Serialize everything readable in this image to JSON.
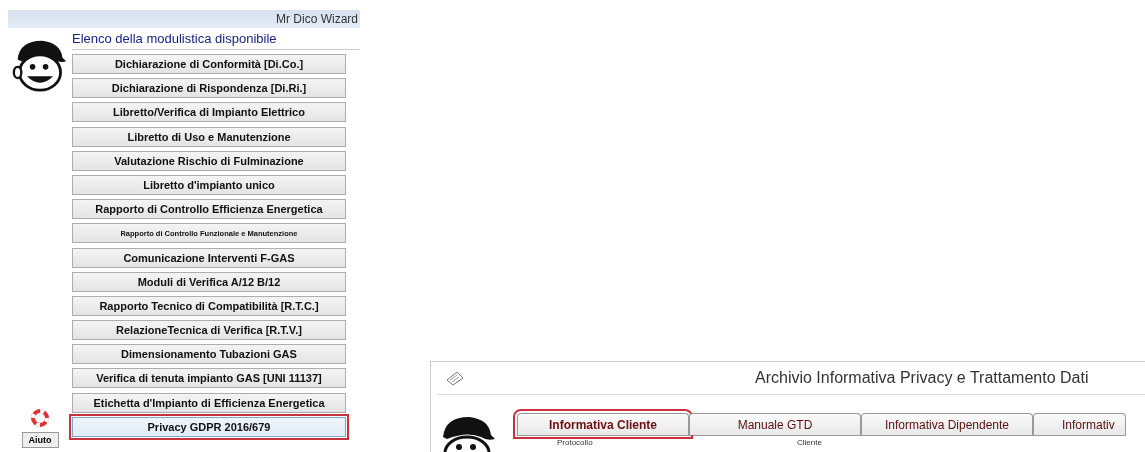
{
  "wizard": {
    "title": "Mr Dico Wizard",
    "heading": "Elenco della modulistica disponibile",
    "buttons": [
      {
        "label": "Dichiarazione di Conformità [Di.Co.]",
        "kind": "normal",
        "highlighted": false
      },
      {
        "label": "Dichiarazione di Rispondenza [Di.Ri.]",
        "kind": "normal",
        "highlighted": false
      },
      {
        "label": "Libretto/Verifica di Impianto Elettrico",
        "kind": "normal",
        "highlighted": false
      },
      {
        "label": "Libretto di Uso e Manutenzione",
        "kind": "normal",
        "highlighted": false
      },
      {
        "label": "Valutazione Rischio di Fulminazione",
        "kind": "normal",
        "highlighted": false
      },
      {
        "label": "Libretto d'impianto unico",
        "kind": "normal",
        "highlighted": false
      },
      {
        "label": "Rapporto di Controllo Efficienza Energetica",
        "kind": "normal",
        "highlighted": false
      },
      {
        "label": "Rapporto di Controllo Funzionale e Manutenzione",
        "kind": "compact",
        "highlighted": false
      },
      {
        "label": "Comunicazione Interventi F-GAS",
        "kind": "normal",
        "highlighted": false
      },
      {
        "label": "Moduli di Verifica A/12 B/12",
        "kind": "normal",
        "highlighted": false
      },
      {
        "label": "Rapporto Tecnico di Compatibilità [R.T.C.]",
        "kind": "normal",
        "highlighted": false
      },
      {
        "label": "RelazioneTecnica di Verifica [R.T.V.]",
        "kind": "normal",
        "highlighted": false
      },
      {
        "label": "Dimensionamento Tubazioni GAS",
        "kind": "normal",
        "highlighted": false
      },
      {
        "label": "Verifica di tenuta impianto GAS [UNI 11137]",
        "kind": "normal",
        "highlighted": false
      },
      {
        "label": "Etichetta d'Impianto di Efficienza Energetica",
        "kind": "normal",
        "highlighted": false
      },
      {
        "label": "Privacy GDPR 2016/679",
        "kind": "normal",
        "highlighted": true
      }
    ],
    "help_button": "Aiuto"
  },
  "archive": {
    "title": "Archivio Informativa Privacy e Trattamento Dati",
    "tabs": [
      {
        "label": "Informativa Cliente",
        "selected": true,
        "highlighted": true
      },
      {
        "label": "Manuale GTD",
        "selected": false,
        "highlighted": false
      },
      {
        "label": "Informativa Dipendente",
        "selected": false,
        "highlighted": false
      },
      {
        "label": "Informativ",
        "selected": false,
        "highlighted": false
      }
    ],
    "columns": [
      "Protocollo",
      "Cliente"
    ]
  }
}
